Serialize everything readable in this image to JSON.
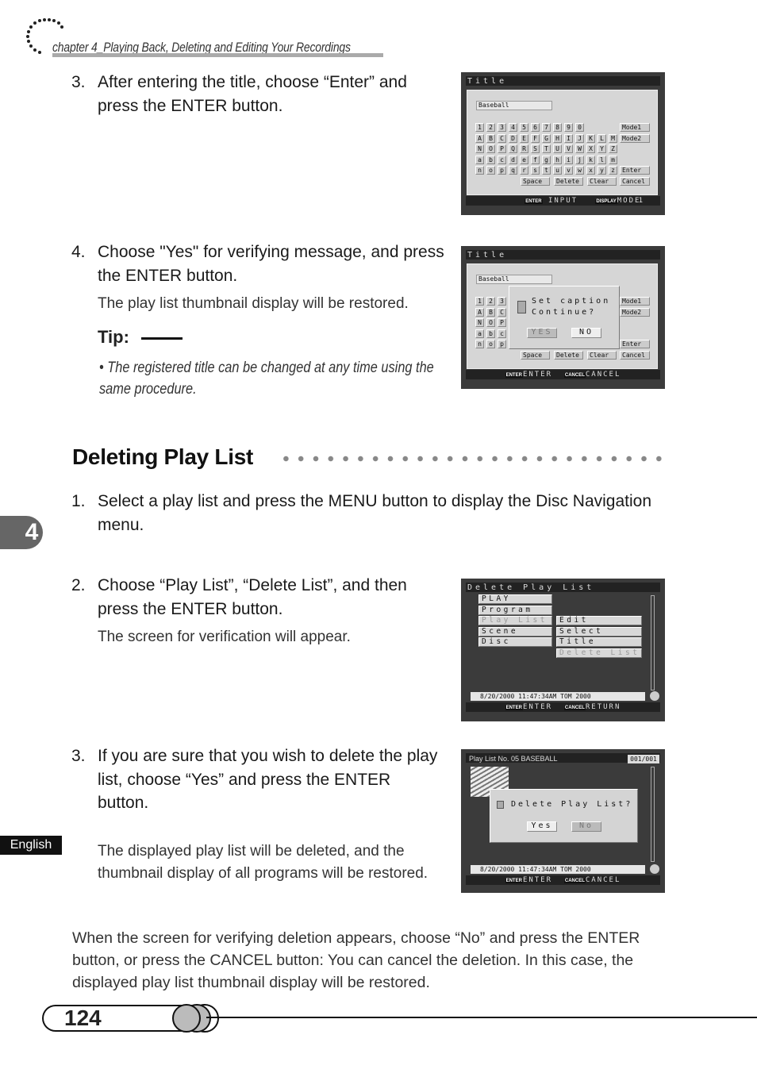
{
  "header": {
    "chapter": "chapter 4_Playing Back, Deleting and Editing Your Recordings"
  },
  "steps_top": [
    {
      "num": "3.",
      "text": "After entering the title, choose “Enter” and press the ENTER button."
    },
    {
      "num": "4.",
      "text": "Choose \"Yes\" for verifying message, and press the ENTER button.",
      "note": "The play list thumbnail display will be restored."
    }
  ],
  "tip": {
    "label": "Tip:",
    "bullet": "•",
    "text": "The registered title can be changed at any time using the same procedure."
  },
  "section": {
    "title": "Deleting Play List"
  },
  "side_tab": {
    "chapter": "4",
    "language": "English"
  },
  "steps": [
    {
      "num": "1.",
      "text": "Select a play list and press the MENU button to display the Disc Navigation menu."
    },
    {
      "num": "2.",
      "text": "Choose “Play List”, “Delete List”, and then press the ENTER button.",
      "note": "The screen for verification will appear."
    },
    {
      "num": "3.",
      "text": "If you are sure that you wish to delete the play list, choose “Yes” and press the ENTER button.",
      "note": "The displayed play list will be deleted, and the thumbnail display of all programs will be restored."
    }
  ],
  "footer_paragraph": "When the screen for verifying deletion appears, choose “No” and press the ENTER button, or press the CANCEL button: You can cancel the deletion. In this case, the displayed play list thumbnail display will be restored.",
  "page_number": "124",
  "screens": {
    "title_input": {
      "title": "Title",
      "field": "Baseball",
      "rows": [
        [
          "1",
          "2",
          "3",
          "4",
          "5",
          "6",
          "7",
          "8",
          "9",
          "0"
        ],
        [
          "A",
          "B",
          "C",
          "D",
          "E",
          "F",
          "G",
          "H",
          "I",
          "J",
          "K",
          "L",
          "M"
        ],
        [
          "N",
          "O",
          "P",
          "Q",
          "R",
          "S",
          "T",
          "U",
          "V",
          "W",
          "X",
          "Y",
          "Z"
        ],
        [
          "a",
          "b",
          "c",
          "d",
          "e",
          "f",
          "g",
          "h",
          "i",
          "j",
          "k",
          "l",
          "m"
        ],
        [
          "n",
          "o",
          "p",
          "q",
          "r",
          "s",
          "t",
          "u",
          "v",
          "w",
          "x",
          "y",
          "z"
        ]
      ],
      "side": [
        "Mode1",
        "Mode2",
        "Enter",
        "Cancel"
      ],
      "bottom_keys": [
        "Space",
        "Delete",
        "Clear"
      ],
      "bar": {
        "k1": "ENTER",
        "a1": "INPUT",
        "k2": "DISPLAY",
        "a2": "MODE",
        "page": "1"
      }
    },
    "title_confirm": {
      "title": "Title",
      "field": "Baseball",
      "msg1": "Set caption",
      "msg2": "Continue?",
      "yes": "YES",
      "no": "NO",
      "bar": {
        "k1": "ENTER",
        "a1": "ENTER",
        "k2": "CANCEL",
        "a2": "CANCEL"
      }
    },
    "delete_menu": {
      "title": "Delete Play List",
      "menu": [
        "PLAY",
        "Program",
        "Play List",
        "Scene",
        "Disc"
      ],
      "submenu": [
        "Edit",
        "Select",
        "Title",
        "Delete List"
      ],
      "status": "8/20/2000 11:47:34AM    TOM 2000",
      "bar": {
        "k1": "ENTER",
        "a1": "ENTER",
        "k2": "CANCEL",
        "a2": "RETURN"
      }
    },
    "delete_confirm": {
      "title": "Play List No. 05 BASEBALL",
      "counter": "001/001",
      "msg": "Delete Play List?",
      "yes": "Yes",
      "no": "No",
      "status": "8/20/2000 11:47:34AM    TOM 2000",
      "bar": {
        "k1": "ENTER",
        "a1": "ENTER",
        "k2": "CANCEL",
        "a2": "CANCEL"
      }
    }
  }
}
